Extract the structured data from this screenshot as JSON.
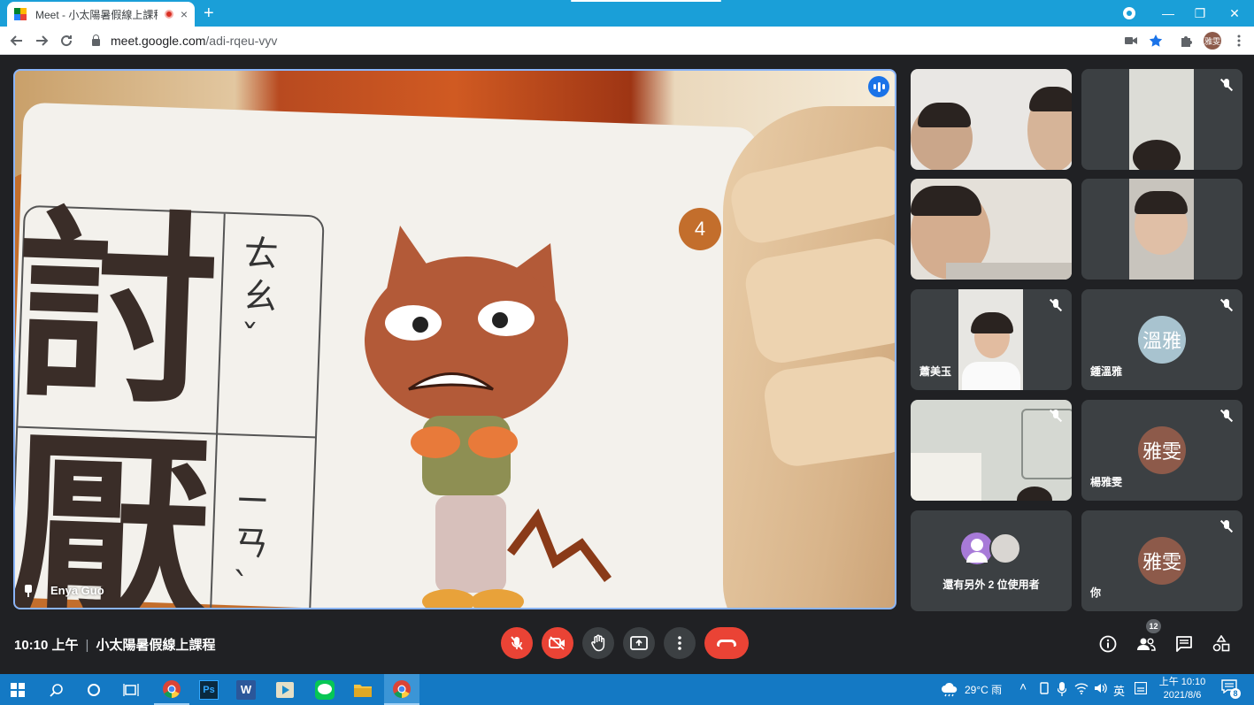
{
  "browser": {
    "tab_title": "Meet - 小太陽暑假線上課程",
    "url_host": "meet.google.com",
    "url_path": "/adi-rqeu-vyv",
    "profile_initials": "雅雯",
    "tab_close_glyph": "×",
    "new_tab_glyph": "+",
    "minimize_glyph": "—",
    "maximize_glyph": "❐",
    "close_glyph": "✕"
  },
  "main_video": {
    "name": "Enya Guo",
    "card_chars": [
      "討",
      "厭"
    ],
    "card_zhuyin": [
      "ㄊㄠˇ",
      "ㄧㄢˋ"
    ],
    "card_number": "4"
  },
  "participants": [
    {
      "name": "",
      "type": "video",
      "muted": false
    },
    {
      "name": "",
      "type": "video",
      "muted": true
    },
    {
      "name": "",
      "type": "video",
      "muted": false
    },
    {
      "name": "",
      "type": "video",
      "muted": false
    },
    {
      "name": "蕭美玉",
      "type": "video",
      "muted": true
    },
    {
      "name": "鍾溫雅",
      "type": "avatar",
      "avatar_text": "溫雅",
      "avatar_color": "#a8c3cf",
      "muted": true
    },
    {
      "name": "",
      "type": "video",
      "muted": true
    },
    {
      "name": "楊雅雯",
      "type": "avatar",
      "avatar_text": "雅雯",
      "avatar_color": "#8d5a4a",
      "muted": true
    },
    {
      "name": "還有另外 2 位使用者",
      "type": "others"
    },
    {
      "name": "你",
      "type": "avatar",
      "avatar_text": "雅雯",
      "avatar_color": "#8d5a4a",
      "muted": true
    }
  ],
  "bottom_bar": {
    "time": "10:10 上午",
    "separator": "|",
    "meeting_title": "小太陽暑假線上課程",
    "people_count": "12"
  },
  "taskbar": {
    "weather": "29°C 雨",
    "ime": "英",
    "time": "上午 10:10",
    "date": "2021/8/6",
    "notifications": "8"
  },
  "colors": {
    "meet_bg": "#202124",
    "tile_bg": "#3c4043",
    "red": "#ea4335",
    "active_border": "#8ab4f8",
    "chrome_tabstrip": "#1a9fd8",
    "taskbar": "#1479c4"
  }
}
